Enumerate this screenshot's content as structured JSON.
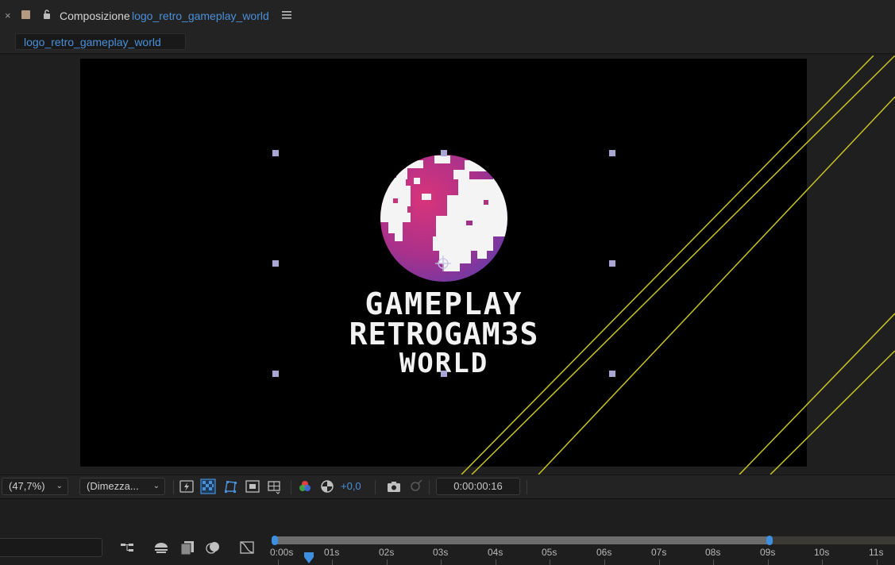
{
  "panel": {
    "close_glyph": "×",
    "title_prefix": "Composizione",
    "comp_name": "logo_retro_gameplay_world",
    "tab_label": "logo_retro_gameplay_world",
    "swatch_color": "#b49a85"
  },
  "logo": {
    "line1": "GAMEPLAY",
    "line2": "RETROGAM3S",
    "line3": "WORLD"
  },
  "viewer_toolbar": {
    "zoom": "(47,7%)",
    "resolution": "(Dimezza...",
    "exposure": "+0,0",
    "timecode": "0:00:00:16",
    "icons": [
      "fast-preview-icon",
      "transparency-grid-icon",
      "mask-visibility-icon",
      "region-of-interest-icon",
      "guides-icon",
      "color-channels-icon",
      "reset-exposure-icon",
      "snapshot-icon",
      "show-snapshot-icon"
    ]
  },
  "timeline": {
    "icons": [
      "comp-flowchart-icon",
      "draft-3d-icon",
      "frame-blending-icon",
      "motion-blur-icon",
      "graph-editor-icon"
    ],
    "ticks": [
      "0:00s",
      "01s",
      "02s",
      "03s",
      "04s",
      "05s",
      "06s",
      "07s",
      "08s",
      "09s",
      "10s",
      "11s"
    ],
    "accent_color": "#3d8fe0"
  },
  "colors": {
    "guide_line": "#c8c423",
    "handle": "#a9a6d6",
    "accent": "#4a90d9"
  }
}
